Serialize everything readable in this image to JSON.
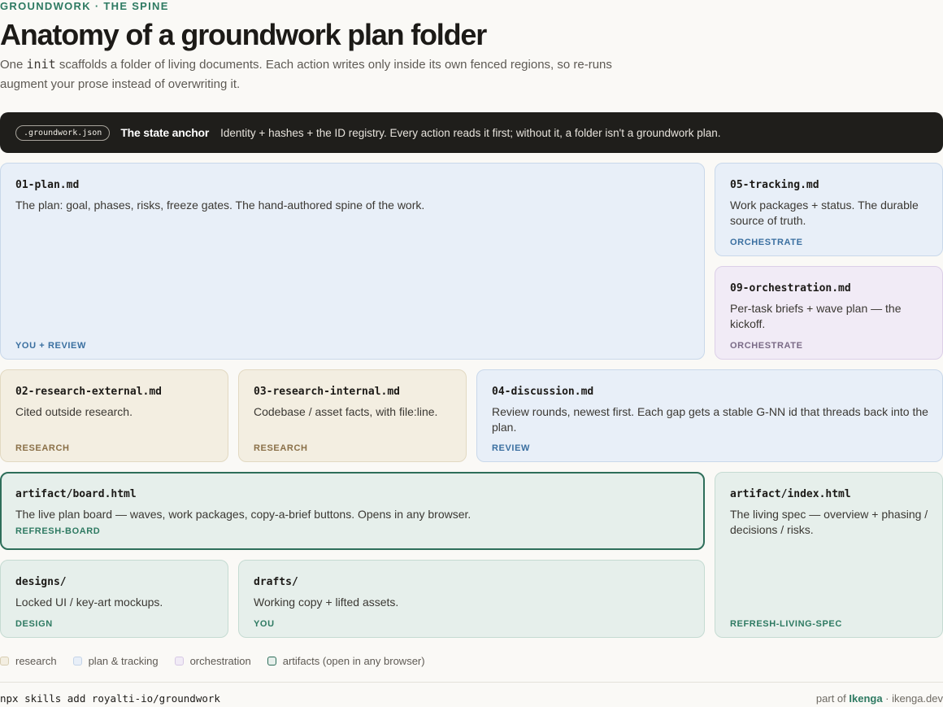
{
  "header": {
    "eyebrow": "GROUNDWORK · THE SPINE",
    "title": "Anatomy of a groundwork plan folder",
    "subtitle_pre": "One ",
    "subtitle_code": "init",
    "subtitle_post": " scaffolds a folder of living documents. Each action writes only inside its own fenced regions, so re-runs augment your prose instead of overwriting it."
  },
  "anchor": {
    "file": ".groundwork.json",
    "title": "The state anchor",
    "description": "Identity + hashes + the ID registry. Every action reads it first; without it, a folder isn't a groundwork plan."
  },
  "cards": {
    "plan": {
      "file": "01-plan.md",
      "desc": "The plan: goal, phases, risks, freeze gates. The hand-authored spine of the work.",
      "tag": "YOU + REVIEW"
    },
    "tracking": {
      "file": "05-tracking.md",
      "desc": "Work packages + status. The durable source of truth.",
      "tag": "ORCHESTRATE"
    },
    "orchestration": {
      "file": "09-orchestration.md",
      "desc": "Per-task briefs + wave plan — the kickoff.",
      "tag": "ORCHESTRATE"
    },
    "research_external": {
      "file": "02-research-external.md",
      "desc": "Cited outside research.",
      "tag": "RESEARCH"
    },
    "research_internal": {
      "file": "03-research-internal.md",
      "desc": "Codebase / asset facts, with file:line.",
      "tag": "RESEARCH"
    },
    "discussion": {
      "file": "04-discussion.md",
      "desc": "Review rounds, newest first. Each gap gets a stable G-NN id that threads back into the plan.",
      "tag": "REVIEW"
    },
    "board": {
      "file": "artifact/board.html",
      "desc": "The live plan board — waves, work packages, copy-a-brief buttons. Opens in any browser.",
      "tag": "REFRESH-BOARD"
    },
    "index": {
      "file": "artifact/index.html",
      "desc": "The living spec — overview + phasing / decisions / risks.",
      "tag": "REFRESH-LIVING-SPEC"
    },
    "designs": {
      "file": "designs/",
      "desc": "Locked UI / key-art mockups.",
      "tag": "DESIGN"
    },
    "drafts": {
      "file": "drafts/",
      "desc": "Working copy + lifted assets.",
      "tag": "YOU"
    }
  },
  "legend": {
    "research": "research",
    "plan_tracking": "plan & tracking",
    "orchestration": "orchestration",
    "artifacts": "artifacts (open in any browser)"
  },
  "footer": {
    "install": "npx skills add royalti-io/groundwork",
    "credit_pre": "part of ",
    "brand": "Ikenga",
    "credit_post": " · ikenga.dev"
  },
  "colors": {
    "accent": "#2e7a62",
    "plan": "#e8eff8",
    "orchestration": "#f1ebf6",
    "research": "#f3eee1",
    "artifacts": "#e6efeb",
    "anchor_bg": "#1f1e1b"
  }
}
